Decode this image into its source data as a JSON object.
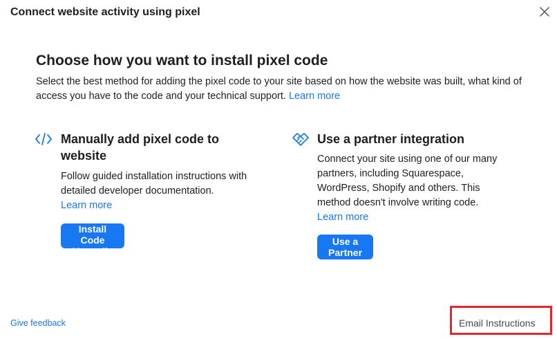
{
  "dialog": {
    "title": "Connect website activity using pixel",
    "close_icon": "close-icon"
  },
  "main": {
    "heading": "Choose how you want to install pixel code",
    "intro_text": "Select the best method for adding the pixel code to your site based on how the website was built, what kind of access you have to the code and your technical support.",
    "intro_link": "Learn more"
  },
  "options": {
    "manual": {
      "icon": "code-icon",
      "title": "Manually add pixel code to website",
      "description": "Follow guided installation instructions with detailed developer documentation.",
      "link": "Learn more",
      "button": "Install Code Manually"
    },
    "partner": {
      "icon": "handshake-icon",
      "title": "Use a partner integration",
      "description": "Connect your site using one of our many partners, including Squarespace, WordPress, Shopify and others. This method doesn't involve writing code.",
      "link": "Learn more",
      "button": "Use a Partner"
    }
  },
  "footer": {
    "feedback": "Give feedback",
    "email": "Email Instructions"
  },
  "colors": {
    "accent": "#1877f2",
    "highlight": "#e3262b"
  }
}
